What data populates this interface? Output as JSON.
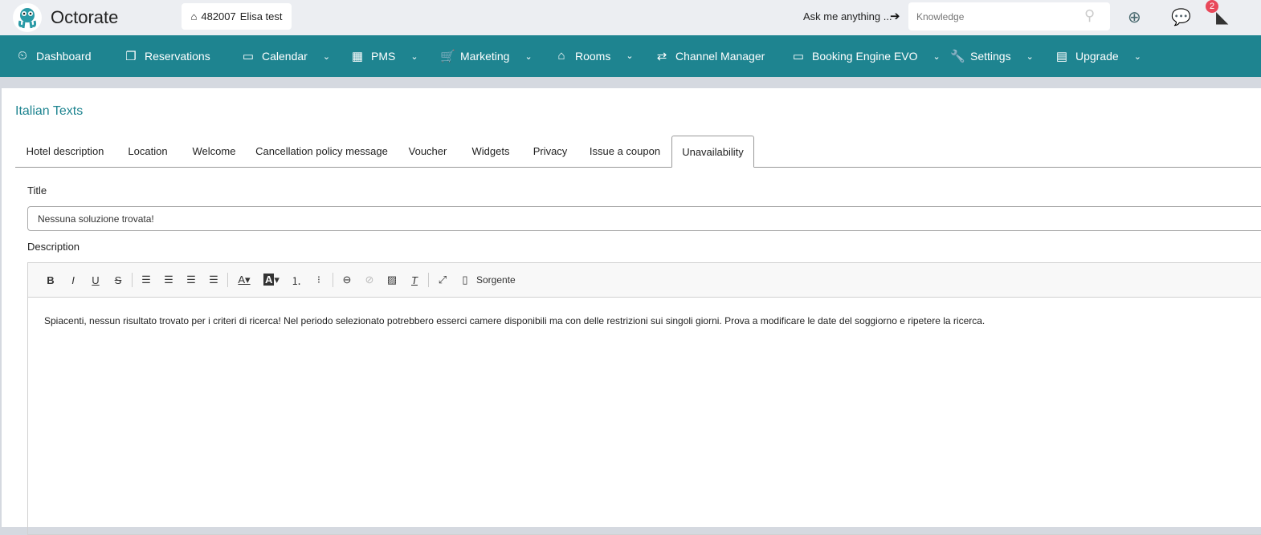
{
  "header": {
    "brand": "Octorate",
    "property_id": "482007",
    "property_name": "Elisa test",
    "ask_label": "Ask me anything ...",
    "search_placeholder": "Knowledge",
    "notification_count": "2"
  },
  "nav": [
    {
      "label": "Dashboard",
      "icon": "⏲",
      "chev": false
    },
    {
      "label": "Reservations",
      "icon": "❐",
      "chev": false
    },
    {
      "label": "Calendar",
      "icon": "▭",
      "chev": true
    },
    {
      "label": "PMS",
      "icon": "▦",
      "chev": true
    },
    {
      "label": "Marketing",
      "icon": "🛒",
      "chev": true
    },
    {
      "label": "Rooms",
      "icon": "⌂",
      "chev": true
    },
    {
      "label": "Channel Manager",
      "icon": "⇄",
      "chev": false
    },
    {
      "label": "Booking Engine EVO",
      "icon": "▭",
      "chev": true
    },
    {
      "label": "Settings",
      "icon": "🔧",
      "chev": true
    },
    {
      "label": "Upgrade",
      "icon": "▤",
      "chev": true
    }
  ],
  "page": {
    "title": "Italian Texts"
  },
  "tabs": [
    "Hotel description",
    "Location",
    "Welcome",
    "Cancellation policy message",
    "Voucher",
    "Widgets",
    "Privacy",
    "Issue a coupon",
    "Unavailability"
  ],
  "active_tab": "Unavailability",
  "form": {
    "title_label": "Title",
    "title_value": "Nessuna soluzione trovata!",
    "description_label": "Description",
    "source_label": "Sorgente",
    "description_text": "Spiacenti, nessun risultato trovato per i criteri di ricerca! Nel periodo selezionato potrebbero esserci camere disponibili ma con delle restrizioni sui singoli giorni. Prova a modificare le date del soggiorno e ripetere la ricerca."
  },
  "colors": {
    "primary": "#1e8490",
    "badge": "#e8485a"
  }
}
